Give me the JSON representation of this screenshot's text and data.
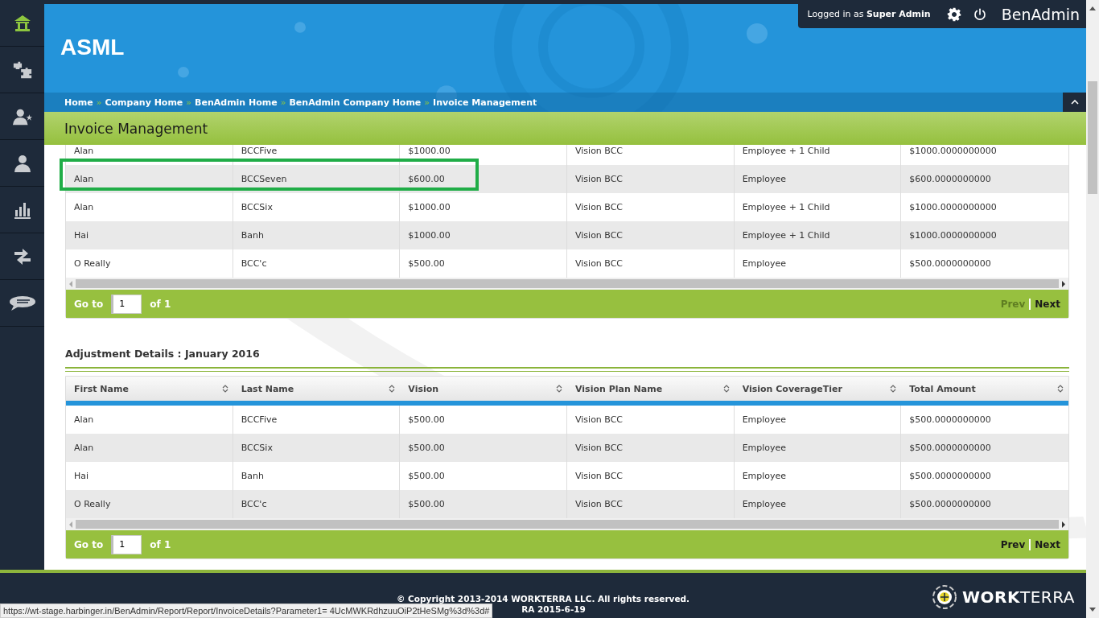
{
  "sidebar": {
    "items": [
      {
        "kind": "home",
        "selected": true
      },
      {
        "kind": "puzzle",
        "selected": false
      },
      {
        "kind": "user-star",
        "selected": false
      },
      {
        "kind": "user",
        "selected": false
      },
      {
        "kind": "chart",
        "selected": false
      },
      {
        "kind": "arrows",
        "selected": false
      },
      {
        "kind": "chat",
        "selected": false
      }
    ]
  },
  "header": {
    "company": "ASML",
    "logged_in_label": "Logged in as",
    "user": "Super Admin",
    "app_name": "BenAdmin"
  },
  "breadcrumbs": [
    "Home",
    "Company Home",
    "BenAdmin Home",
    "BenAdmin Company Home",
    "Invoice Management"
  ],
  "breadcrumb_separator": "»",
  "page_title": "Invoice Management",
  "invoice_table": {
    "rows": [
      [
        "Alan",
        "BCCFive",
        "$1000.00",
        "Vision BCC",
        "Employee + 1 Child",
        "$1000.0000000000"
      ],
      [
        "Alan",
        "BCCSeven",
        "$600.00",
        "Vision BCC",
        "Employee",
        "$600.0000000000"
      ],
      [
        "Alan",
        "BCCSix",
        "$1000.00",
        "Vision BCC",
        "Employee + 1 Child",
        "$1000.0000000000"
      ],
      [
        "Hai",
        "Banh",
        "$1000.00",
        "Vision BCC",
        "Employee + 1 Child",
        "$1000.0000000000"
      ],
      [
        "O Really",
        "BCC'c",
        "$500.00",
        "Vision BCC",
        "Employee",
        "$500.0000000000"
      ]
    ],
    "pager": {
      "goto_label": "Go to",
      "page": "1",
      "of_label": "of 1",
      "prev": "Prev",
      "prev_disabled": true,
      "next": "Next"
    }
  },
  "adjustment": {
    "title": "Adjustment Details : January 2016",
    "columns": [
      "First Name",
      "Last Name",
      "Vision",
      "Vision Plan Name",
      "Vision CoverageTier",
      "Total Amount"
    ],
    "rows": [
      [
        "Alan",
        "BCCFive",
        "$500.00",
        "Vision BCC",
        "Employee",
        "$500.0000000000"
      ],
      [
        "Alan",
        "BCCSix",
        "$500.00",
        "Vision BCC",
        "Employee",
        "$500.0000000000"
      ],
      [
        "Hai",
        "Banh",
        "$500.00",
        "Vision BCC",
        "Employee",
        "$500.0000000000"
      ],
      [
        "O Really",
        "BCC'c",
        "$500.00",
        "Vision BCC",
        "Employee",
        "$500.0000000000"
      ]
    ],
    "pager": {
      "goto_label": "Go to",
      "page": "1",
      "of_label": "of 1",
      "prev": "Prev",
      "prev_disabled": false,
      "next": "Next"
    }
  },
  "footer": {
    "copyright": "© Copyright 2013-2014 WORKTERRA LLC. All rights reserved.",
    "version": "RA 2015-6-19",
    "brand_bold": "WORK",
    "brand_light": "TERRA"
  },
  "status_url": "https://wt-stage.harbinger.in/BenAdmin/Report/Report/InvoiceDetails?Parameter1= 4UcMWKRdhzuuOiP2tHeSMg%3d%3d#"
}
